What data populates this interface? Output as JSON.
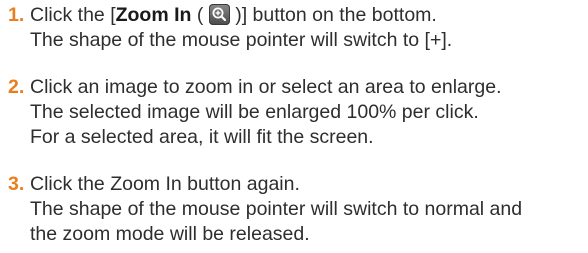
{
  "steps": [
    {
      "number": "1.",
      "line1_prefix": "Click the [",
      "line1_bold": "Zoom In",
      "line1_open": " ( ",
      "line1_suffix": " )] button on the bottom.",
      "line2": "The shape of the mouse pointer will switch to [+].",
      "icon": "zoom-in-icon"
    },
    {
      "number": "2.",
      "line1": "Click an image to zoom in or select an area to enlarge.",
      "line2": "The selected image will be enlarged 100% per click.",
      "line3": "For a selected area, it will fit the screen."
    },
    {
      "number": "3.",
      "line1": "Click the Zoom In button again.",
      "line2": "The shape of the mouse pointer will switch to normal and",
      "line3": "the zoom mode will be released."
    }
  ],
  "colors": {
    "number": "#e87f1e",
    "text": "#2e2e2e",
    "icon_bg": "#5a5a5a"
  }
}
